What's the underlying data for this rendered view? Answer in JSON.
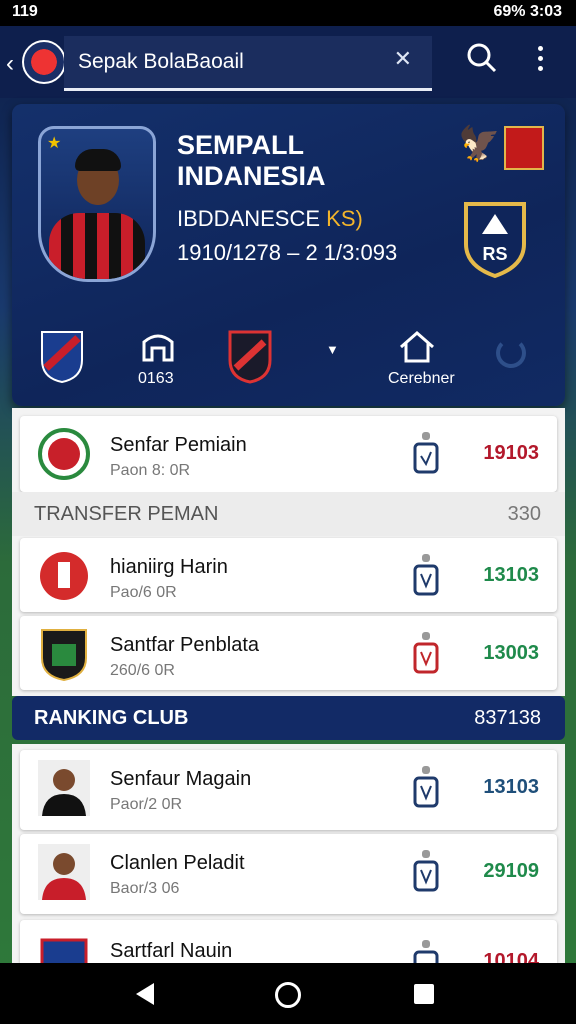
{
  "status_bar": {
    "left_text": "119",
    "right_text": "69% 3:03"
  },
  "app_bar": {
    "search_value": "Sepak BolaBaoail",
    "back_icon": "back-arrow-icon",
    "search_icon": "search-icon",
    "more_icon": "more-vert-icon"
  },
  "hero": {
    "title": "SEMPALL INDANESIA",
    "subtitle_main": "IBDDANESCE",
    "subtitle_tag": "KS)",
    "stat_line": "1910/1278 – 2 1/3:093",
    "badge_text": "RS",
    "team_labels": [
      "0163",
      "Cerebner"
    ]
  },
  "players": [
    {
      "name": "Senfar Pemiain",
      "meta": "Paon 8: 0R",
      "value": "19103",
      "value_color": "#b3182b",
      "lock_color": "#1f3a6b"
    }
  ],
  "transfer_section": {
    "title": "TRANSFER PEMAN",
    "count": "330"
  },
  "transfers": [
    {
      "name": "hianiirg Harin",
      "meta": "Pao/6 0R",
      "value": "13103",
      "value_color": "#1f8a4b",
      "lock_color": "#1f3a6b"
    },
    {
      "name": "Santfar Penblata",
      "meta": "260/6 0R",
      "value": "13003",
      "value_color": "#1f8a4b",
      "lock_color": "#c0262b"
    }
  ],
  "ranking_section": {
    "title": "RANKING CLUB",
    "count": "837138"
  },
  "rankings": [
    {
      "name": "Senfaur Magain",
      "meta": "Paor/2 0R",
      "value": "13103",
      "value_color": "#1f4f7a",
      "lock_color": "#1f3a6b"
    },
    {
      "name": "Clanlen Peladit",
      "meta": "Baor/3 06",
      "value": "29109",
      "value_color": "#1f8a4b",
      "lock_color": "#1f3a6b"
    },
    {
      "name": "Sartfarl Nauin",
      "meta": "",
      "value": "10104",
      "value_color": "#b3182b",
      "lock_color": "#1f3a6b"
    }
  ]
}
